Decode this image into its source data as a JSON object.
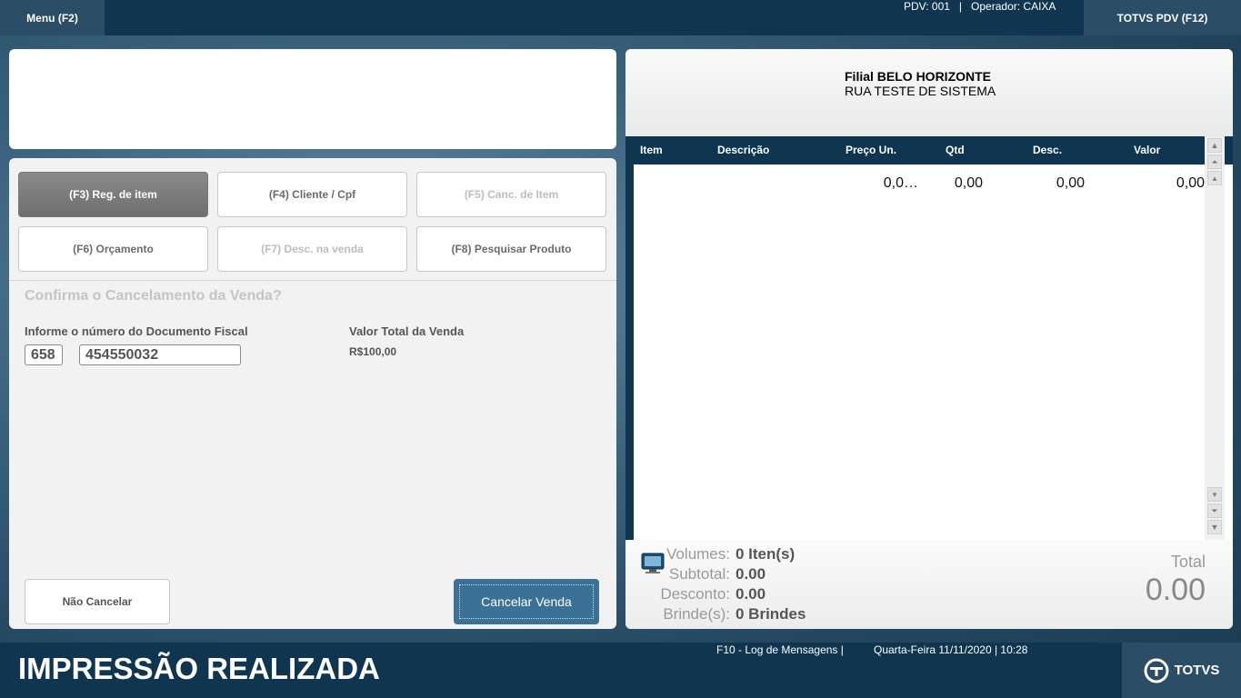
{
  "topbar": {
    "menu_label": "Menu (F2)",
    "pdv": "PDV: 001",
    "separator": "|",
    "operator": "Operador: CAIXA",
    "app_label": "TOTVS PDV (F12)"
  },
  "function_buttons": [
    {
      "label": "(F3) Reg. de item",
      "state": "active"
    },
    {
      "label": "(F4) Cliente / Cpf",
      "state": "enabled"
    },
    {
      "label": "(F5) Canc. de Item",
      "state": "disabled"
    },
    {
      "label": "(F6) Orçamento",
      "state": "enabled"
    },
    {
      "label": "(F7) Desc. na venda",
      "state": "disabled"
    },
    {
      "label": "(F8) Pesquisar Produto",
      "state": "enabled"
    }
  ],
  "cancel_form": {
    "title": "Confirma o Cancelamento da Venda?",
    "doc_label": "Informe o número do Documento Fiscal",
    "serie_value": "658",
    "doc_value": "454550032",
    "total_label": "Valor Total da Venda",
    "total_value": "R$100,00",
    "no_cancel_label": "Não Cancelar",
    "cancel_label": "Cancelar Venda"
  },
  "receipt": {
    "branch_prefix": "Filial",
    "branch_name": "BELO HORIZONTE",
    "address": "RUA TESTE DE SISTEMA",
    "columns": [
      "Item",
      "Descrição",
      "Preço Un.",
      "Qtd",
      "Desc.",
      "Valor"
    ],
    "row": {
      "preco": "0,0…",
      "qtd": "0,00",
      "desc": "0,00",
      "valor": "0,00"
    },
    "summary": {
      "volumes_label": "Volumes:",
      "volumes_value": "0 Iten(s)",
      "subtotal_label": "Subtotal:",
      "subtotal_value": "0.00",
      "desconto_label": "Desconto:",
      "desconto_value": "0.00",
      "brindes_label": "Brinde(s):",
      "brindes_value": "0 Brindes",
      "total_label": "Total",
      "total_value": "0.00"
    }
  },
  "bottombar": {
    "status": "IMPRESSÃO REALIZADA",
    "log": "F10 - Log de Mensagens |",
    "datetime": "Quarta-Feira 11/11/2020 | 10:28",
    "logo_text": "TOTVS"
  },
  "colors": {
    "navy": "#0f3550",
    "accent_button": "#3b7196",
    "active_button": "#7a7a7a"
  }
}
